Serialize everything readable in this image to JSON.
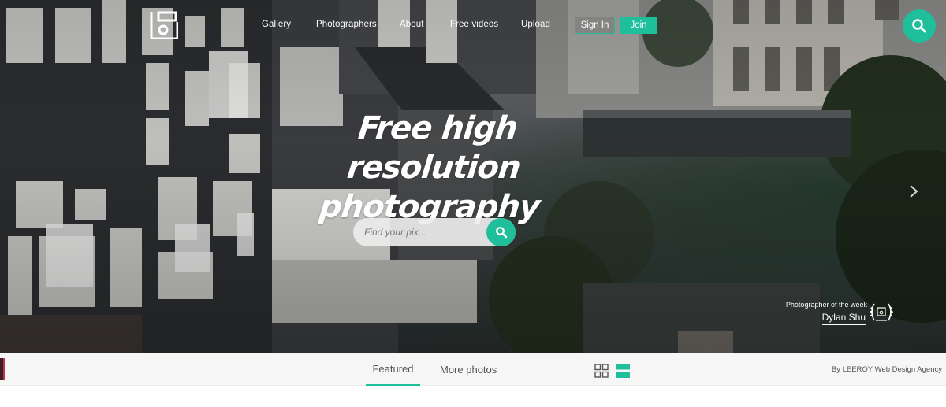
{
  "header": {
    "nav": [
      "Gallery",
      "Photographers",
      "About",
      "Free videos",
      "Upload"
    ],
    "signin_label": "Sign In",
    "join_label": "Join"
  },
  "hero": {
    "headline_line1": "Free high resolution",
    "headline_line2": "photography",
    "search_placeholder": "Find your pix..."
  },
  "photographer_of_week": {
    "label": "Photographer of the week",
    "name": "Dylan Shu"
  },
  "bottom_bar": {
    "tabs": [
      "Featured",
      "More photos"
    ],
    "active_tab": "Featured",
    "credit": "By LEEROY Web Design Agency"
  },
  "colors": {
    "accent": "#1fbf9b",
    "bar_background": "#f6f6f6",
    "text_light": "#ffffff"
  },
  "icons": [
    "logo-icon",
    "search-icon",
    "chevron-right-icon",
    "laurel-badge-icon",
    "grid-view-icon",
    "list-view-icon"
  ]
}
